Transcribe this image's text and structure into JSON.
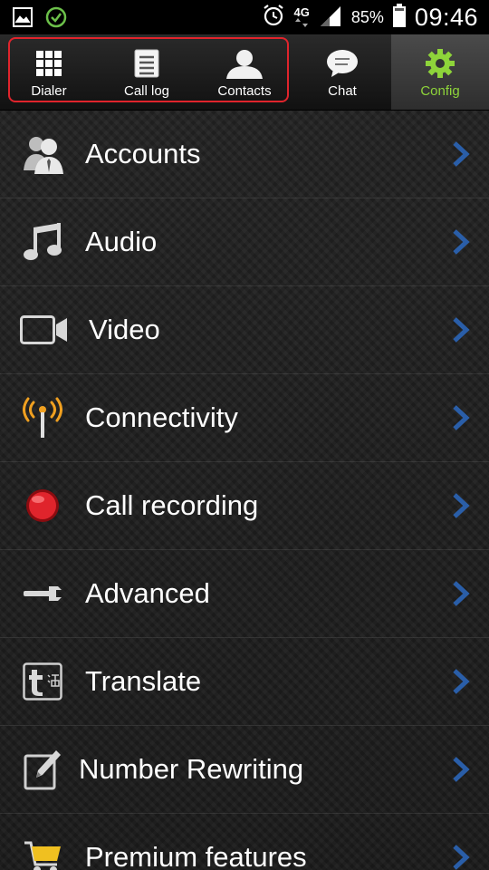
{
  "status_bar": {
    "network": "4G",
    "battery": "85%",
    "time": "09:46",
    "icons": [
      "gallery-icon",
      "check-circle-icon",
      "alarm-icon",
      "signal-icon",
      "battery-icon"
    ]
  },
  "tabs": [
    {
      "label": "Dialer",
      "icon": "keypad-icon"
    },
    {
      "label": "Call log",
      "icon": "call-log-icon"
    },
    {
      "label": "Contacts",
      "icon": "contact-icon"
    },
    {
      "label": "Chat",
      "icon": "chat-bubble-icon"
    },
    {
      "label": "Config",
      "icon": "gear-icon",
      "active": true
    }
  ],
  "settings": [
    {
      "label": "Accounts",
      "icon": "accounts-icon"
    },
    {
      "label": "Audio",
      "icon": "music-note-icon"
    },
    {
      "label": "Video",
      "icon": "video-camera-icon"
    },
    {
      "label": "Connectivity",
      "icon": "antenna-icon"
    },
    {
      "label": "Call recording",
      "icon": "record-icon"
    },
    {
      "label": "Advanced",
      "icon": "wrench-icon"
    },
    {
      "label": "Translate",
      "icon": "translate-icon"
    },
    {
      "label": "Number Rewriting",
      "icon": "edit-icon"
    },
    {
      "label": "Premium features",
      "icon": "cart-icon"
    }
  ],
  "colors": {
    "active_tab": "#8ed43a",
    "highlight_outline": "#e0242c",
    "chevron": "#2a5ea8",
    "record_red": "#e0242c",
    "antenna_orange": "#f0a020"
  }
}
